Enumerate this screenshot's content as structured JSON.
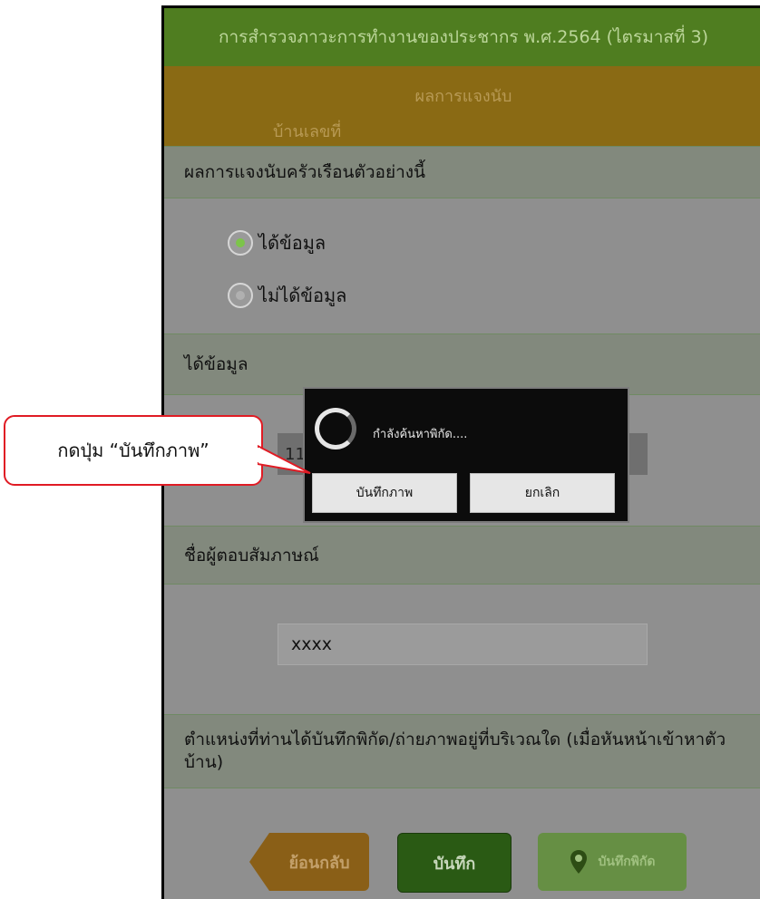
{
  "survey_title": "การสำรวจภาวะการทำงานของประชากร พ.ศ.2564 (ไตรมาสที่ 3)",
  "header": {
    "result_label": "ผลการแจงนับ",
    "house_number_label": "บ้านเลขที่"
  },
  "sections": {
    "household_result": "ผลการแจงนับครัวเรือนตัวอย่างนี้",
    "got_data_header": "ได้ข้อมูล",
    "respondent_name": "ชื่อผู้ตอบสัมภาษณ์",
    "location_question": "ตำแหน่งที่ท่านได้บันทึกพิกัด/ถ่ายภาพอยู่ที่บริเวณใด (เมื่อหันหน้าเข้าหาตัวบ้าน)"
  },
  "radio_options": [
    {
      "label": "ได้ข้อมูล",
      "selected": true
    },
    {
      "label": "ไม่ได้ข้อมูล",
      "selected": false
    }
  ],
  "spinner_value": "11",
  "respondent_input_value": "xxxx",
  "nav": {
    "back": "ย้อนกลับ",
    "save": "บันทึก",
    "save_gps": "บันทึกพิกัด"
  },
  "dialog": {
    "message": "กำลังค้นหาพิกัด....",
    "save_photo_button": "บันทึกภาพ",
    "cancel_button": "ยกเลิก"
  },
  "callout_text": "กดปุ่ม “บันทึกภาพ”",
  "colors": {
    "accent_green": "#4f7d20",
    "header_brown": "#8a6a14",
    "callout_red": "#e01b24"
  }
}
